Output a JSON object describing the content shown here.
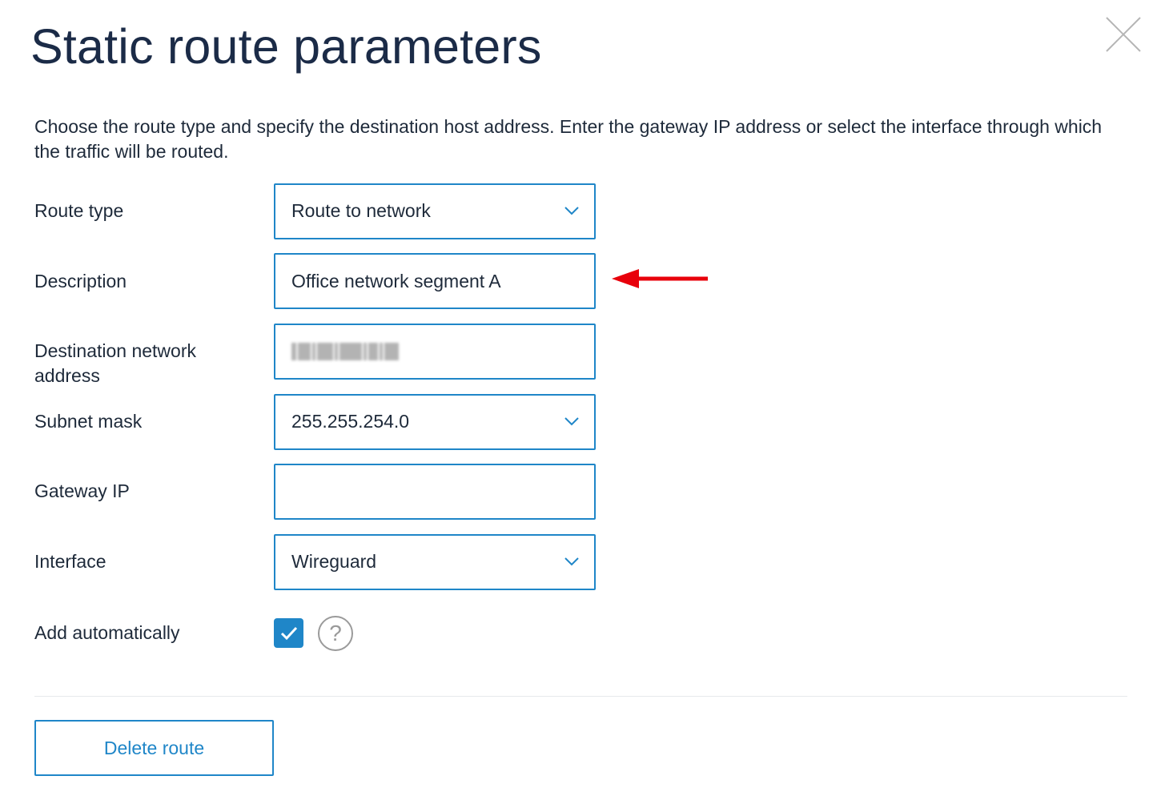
{
  "dialog": {
    "title": "Static route parameters",
    "intro": "Choose the route type and specify the destination host address. Enter the gateway IP address or select the interface through which the traffic will be routed."
  },
  "form": {
    "route_type": {
      "label": "Route type",
      "value": "Route to network"
    },
    "description": {
      "label": "Description",
      "value": "Office network segment A"
    },
    "destination": {
      "label": "Destination network address"
    },
    "subnet_mask": {
      "label": "Subnet mask",
      "value": "255.255.254.0"
    },
    "gateway_ip": {
      "label": "Gateway IP",
      "value": ""
    },
    "interface": {
      "label": "Interface",
      "value": "Wireguard"
    },
    "add_automatically": {
      "label": "Add automatically",
      "checked": true,
      "help_glyph": "?"
    }
  },
  "actions": {
    "delete_label": "Delete route"
  },
  "icons": {
    "close": "close-icon",
    "dropdown": "chevron-down-icon",
    "check": "checkmark-icon",
    "help": "question-circle-icon",
    "annotation": "red-arrow-icon"
  },
  "colors": {
    "accent": "#1f86c8",
    "title": "#1b2b47",
    "text": "#1e2a3a",
    "annotation": "#e8000b"
  }
}
